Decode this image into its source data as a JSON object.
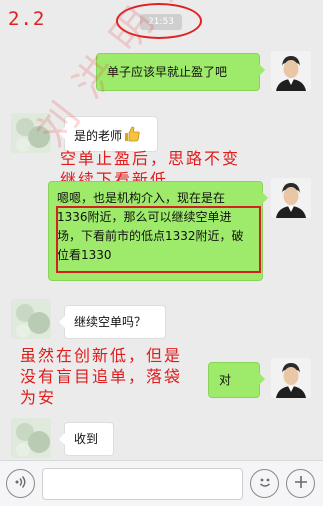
{
  "corner_tag": "2.2",
  "timestamp": "21:53",
  "messages": [
    {
      "sender": "me",
      "text": "单子应该早就止盈了吧"
    },
    {
      "sender": "other",
      "text": "是的老师"
    },
    {
      "sender": "other",
      "text": "嗯嗯，也是机构介入，现在是在1336附近，那么可以继续空单进场，下看前市的低点1332附近，破位看1330"
    },
    {
      "sender": "other",
      "text": "继续空单吗？"
    },
    {
      "sender": "me",
      "text": "对"
    },
    {
      "sender": "other",
      "text": "收到"
    }
  ],
  "annotations": {
    "note1_line1": "空单止盈后，思路不变",
    "note1_line2": "继续下看新低",
    "note2_line1": "虽然在创新低，但是",
    "note2_line2": "没有盲目追单，落袋",
    "note2_line3": "为安"
  },
  "watermark": "刘洪明讲话",
  "colors": {
    "chat_background": "#ebebeb",
    "my_bubble": "#9eea6a",
    "their_bubble": "#ffffff",
    "annotation_red": "#e01c1c",
    "input_bar": "#f5f5f7"
  },
  "input_bar": {
    "voice_icon": "voice-icon",
    "emoji_icon": "emoji-icon",
    "plus_icon": "plus-icon"
  }
}
